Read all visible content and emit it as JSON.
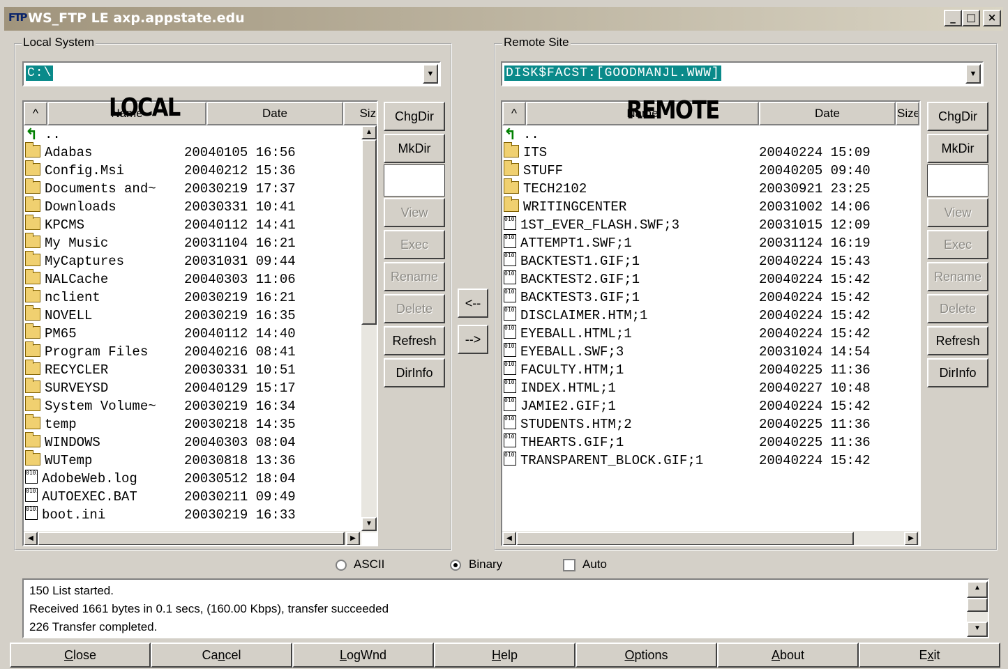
{
  "window": {
    "title": "WS_FTP LE axp.appstate.edu",
    "icon": "ftp-app-icon",
    "controls": {
      "minimize": "_",
      "maximize": "□",
      "close": "×"
    }
  },
  "local": {
    "group_label": "Local System",
    "path": "C:\\",
    "overlay_label": "LOCAL",
    "columns": {
      "sort": "^",
      "name": "Name",
      "date": "Date",
      "size": "Size"
    },
    "rows": [
      {
        "icon": "up",
        "name": "..",
        "date": ""
      },
      {
        "icon": "folder",
        "name": "Adabas",
        "date": "20040105 16:56"
      },
      {
        "icon": "folder",
        "name": "Config.Msi",
        "date": "20040212 15:36"
      },
      {
        "icon": "folder",
        "name": "Documents and~",
        "date": "20030219 17:37"
      },
      {
        "icon": "folder",
        "name": "Downloads",
        "date": "20030331 10:41"
      },
      {
        "icon": "folder",
        "name": "KPCMS",
        "date": "20040112 14:41"
      },
      {
        "icon": "folder",
        "name": "My Music",
        "date": "20031104 16:21"
      },
      {
        "icon": "folder",
        "name": "MyCaptures",
        "date": "20031031 09:44"
      },
      {
        "icon": "folder",
        "name": "NALCache",
        "date": "20040303 11:06"
      },
      {
        "icon": "folder",
        "name": "nclient",
        "date": "20030219 16:21"
      },
      {
        "icon": "folder",
        "name": "NOVELL",
        "date": "20030219 16:35"
      },
      {
        "icon": "folder",
        "name": "PM65",
        "date": "20040112 14:40"
      },
      {
        "icon": "folder",
        "name": "Program Files",
        "date": "20040216 08:41"
      },
      {
        "icon": "folder",
        "name": "RECYCLER",
        "date": "20030331 10:51"
      },
      {
        "icon": "folder",
        "name": "SURVEYSD",
        "date": "20040129 15:17"
      },
      {
        "icon": "folder",
        "name": "System Volume~",
        "date": "20030219 16:34"
      },
      {
        "icon": "folder",
        "name": "temp",
        "date": "20030218 14:35"
      },
      {
        "icon": "folder",
        "name": "WINDOWS",
        "date": "20040303 08:04"
      },
      {
        "icon": "folder",
        "name": "WUTemp",
        "date": "20030818 13:36"
      },
      {
        "icon": "file",
        "name": "AdobeWeb.log",
        "date": "20030512 18:04"
      },
      {
        "icon": "file",
        "name": "AUTOEXEC.BAT",
        "date": "20030211 09:49"
      },
      {
        "icon": "file",
        "name": "boot.ini",
        "date": "20030219 16:33"
      }
    ],
    "buttons": {
      "chgdir": "ChgDir",
      "mkdir": "MkDir",
      "view": "View",
      "exec": "Exec",
      "rename": "Rename",
      "delete": "Delete",
      "refresh": "Refresh",
      "dirinfo": "DirInfo"
    }
  },
  "remote": {
    "group_label": "Remote Site",
    "path": "DISK$FACST:[GOODMANJL.WWW]",
    "overlay_label": "REMOTE",
    "columns": {
      "sort": "^",
      "name": "Name",
      "date": "Date",
      "size": "Size"
    },
    "rows": [
      {
        "icon": "up",
        "name": "..",
        "date": ""
      },
      {
        "icon": "folder",
        "name": "ITS",
        "date": "20040224 15:09"
      },
      {
        "icon": "folder",
        "name": "STUFF",
        "date": "20040205 09:40"
      },
      {
        "icon": "folder",
        "name": "TECH2102",
        "date": "20030921 23:25"
      },
      {
        "icon": "folder",
        "name": "WRITINGCENTER",
        "date": "20031002 14:06"
      },
      {
        "icon": "file",
        "name": "1ST_EVER_FLASH.SWF;3",
        "date": "20031015 12:09"
      },
      {
        "icon": "file",
        "name": "ATTEMPT1.SWF;1",
        "date": "20031124 16:19"
      },
      {
        "icon": "file",
        "name": "BACKTEST1.GIF;1",
        "date": "20040224 15:43"
      },
      {
        "icon": "file",
        "name": "BACKTEST2.GIF;1",
        "date": "20040224 15:42"
      },
      {
        "icon": "file",
        "name": "BACKTEST3.GIF;1",
        "date": "20040224 15:42"
      },
      {
        "icon": "file",
        "name": "DISCLAIMER.HTM;1",
        "date": "20040224 15:42"
      },
      {
        "icon": "file",
        "name": "EYEBALL.HTML;1",
        "date": "20040224 15:42"
      },
      {
        "icon": "file",
        "name": "EYEBALL.SWF;3",
        "date": "20031024 14:54"
      },
      {
        "icon": "file",
        "name": "FACULTY.HTM;1",
        "date": "20040225 11:36"
      },
      {
        "icon": "file",
        "name": "INDEX.HTML;1",
        "date": "20040227 10:48"
      },
      {
        "icon": "file",
        "name": "JAMIE2.GIF;1",
        "date": "20040224 15:42"
      },
      {
        "icon": "file",
        "name": "STUDENTS.HTM;2",
        "date": "20040225 11:36"
      },
      {
        "icon": "file",
        "name": "THEARTS.GIF;1",
        "date": "20040225 11:36"
      },
      {
        "icon": "file",
        "name": "TRANSPARENT_BLOCK.GIF;1",
        "date": "20040224 15:42"
      }
    ],
    "buttons": {
      "chgdir": "ChgDir",
      "mkdir": "MkDir",
      "view": "View",
      "exec": "Exec",
      "rename": "Rename",
      "delete": "Delete",
      "refresh": "Refresh",
      "dirinfo": "DirInfo"
    }
  },
  "transfer": {
    "to_local": "<--",
    "to_remote": "-->"
  },
  "mode": {
    "ascii": "ASCII",
    "binary": "Binary",
    "auto": "Auto",
    "selected": "binary",
    "auto_checked": false
  },
  "log": {
    "lines": [
      "150 List started.",
      "Received 1661 bytes in 0.1 secs, (160.00 Kbps), transfer succeeded",
      "226 Transfer completed."
    ]
  },
  "bottom_buttons": [
    {
      "label": "Close",
      "underline": "C"
    },
    {
      "label": "Cancel",
      "underline": "n"
    },
    {
      "label": "LogWnd",
      "underline": "L"
    },
    {
      "label": "Help",
      "underline": "H"
    },
    {
      "label": "Options",
      "underline": "O"
    },
    {
      "label": "About",
      "underline": "A"
    },
    {
      "label": "Exit",
      "underline": "x"
    }
  ]
}
